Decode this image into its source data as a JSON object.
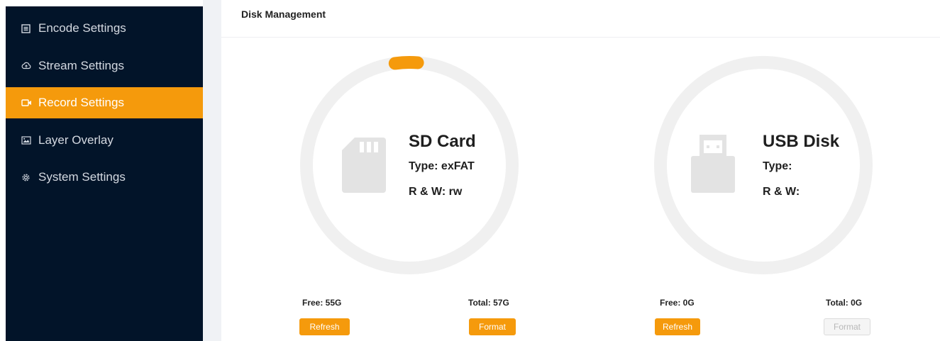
{
  "sidebar": {
    "items": [
      {
        "label": "Encode Settings",
        "icon": "encode-icon"
      },
      {
        "label": "Stream Settings",
        "icon": "stream-icon"
      },
      {
        "label": "Record Settings",
        "icon": "record-icon",
        "active": true
      },
      {
        "label": "Layer Overlay",
        "icon": "layer-icon"
      },
      {
        "label": "System Settings",
        "icon": "gear-icon"
      }
    ],
    "accent": "#f59a0c",
    "background": "#021429"
  },
  "header": {
    "title": "Disk Management"
  },
  "disks": [
    {
      "name": "SD Card",
      "type": "Type: exFAT",
      "rw": "R & W: rw",
      "free": "Free: 55G",
      "total": "Total: 57G",
      "refresh_label": "Refresh",
      "format_label": "Format",
      "icon": "sd-card-icon",
      "used_fraction": 0.035,
      "format_enabled": true
    },
    {
      "name": "USB Disk",
      "type": "Type:",
      "rw": "R & W:",
      "free": "Free: 0G",
      "total": "Total: 0G",
      "refresh_label": "Refresh",
      "format_label": "Format",
      "icon": "usb-drive-icon",
      "used_fraction": 0,
      "format_enabled": false
    }
  ]
}
